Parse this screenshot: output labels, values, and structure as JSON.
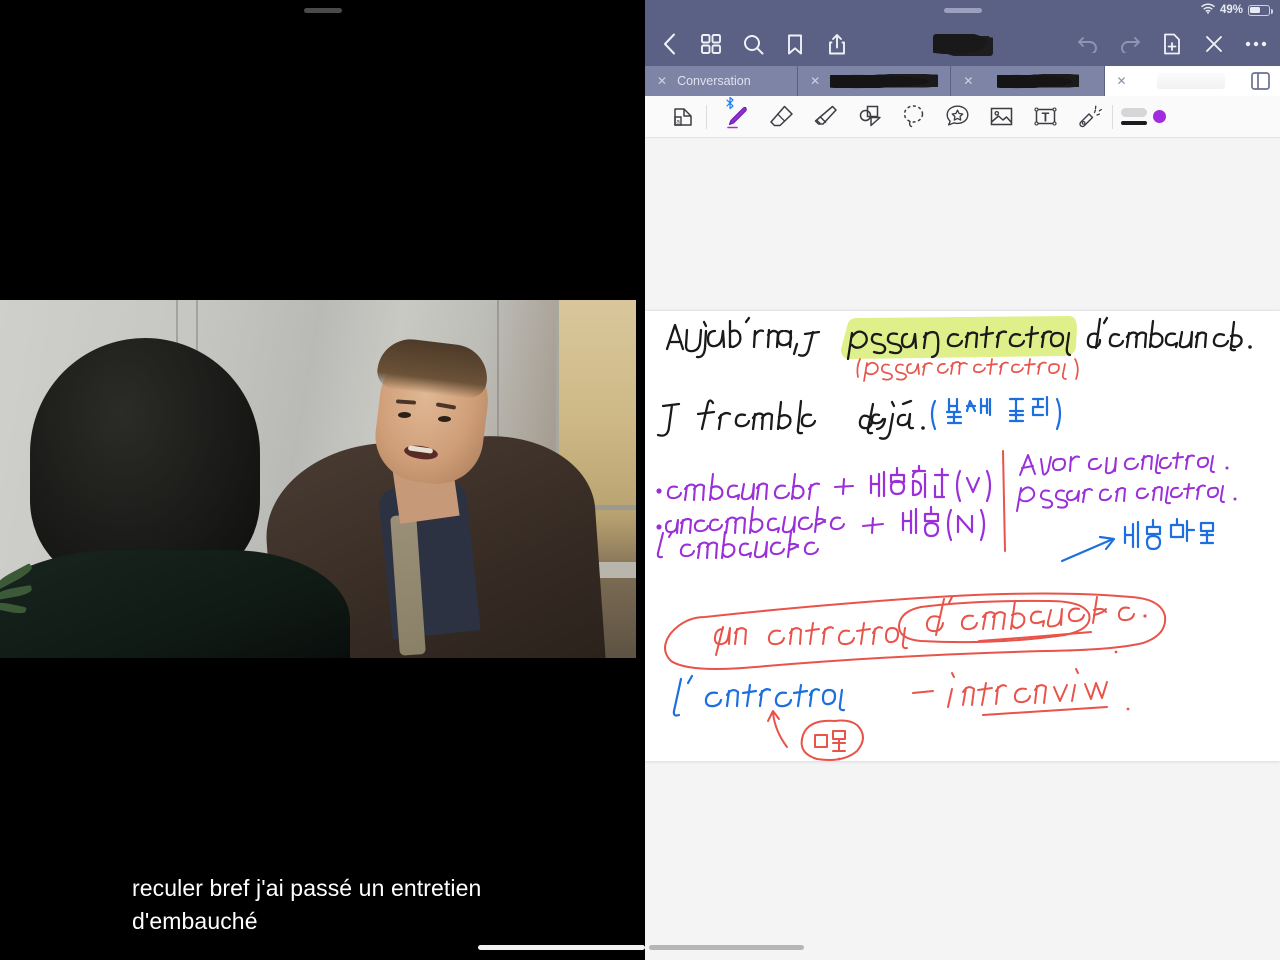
{
  "app": {
    "name": "handwriting-notes-app"
  },
  "video": {
    "subtitle_line1": "reculer bref j'ai passé un entretien",
    "subtitle_line2": "d'embauché",
    "scene_description": "Two men in an office, job interview scene"
  },
  "status_bar": {
    "battery_percent": "49%",
    "wifi_icon": "wifi-icon",
    "battery_icon": "battery-icon",
    "battery_level": 49
  },
  "nav_bar": {
    "back_icon": "back-chevron-icon",
    "grid_icon": "grid-thumbnails-icon",
    "search_icon": "search-icon",
    "bookmark_icon": "bookmark-icon",
    "share_icon": "share-icon",
    "title_redacted": "",
    "undo_icon": "undo-icon",
    "redo_icon": "redo-icon",
    "add_page_icon": "add-page-icon",
    "close_icon": "close-icon",
    "more_icon": "more-ellipsis-icon"
  },
  "tabs": {
    "close_glyph": "✕",
    "items": [
      {
        "label": "Conversation",
        "redacted": false,
        "active": false
      },
      {
        "label": "",
        "redacted": true,
        "active": false
      },
      {
        "label": "",
        "redacted": true,
        "active": false
      },
      {
        "label": "",
        "redacted": true,
        "active": true
      }
    ],
    "split_view_icon": "split-view-icon"
  },
  "toolbar": {
    "tools": [
      {
        "name": "page-flip-tool",
        "selected": false
      },
      {
        "name": "pen-tool",
        "selected": true,
        "bluetooth": true
      },
      {
        "name": "eraser-tool",
        "selected": false
      },
      {
        "name": "highlighter-tool",
        "selected": false
      },
      {
        "name": "shapes-tool",
        "selected": false
      },
      {
        "name": "lasso-select-tool",
        "selected": false
      },
      {
        "name": "sticker-tool",
        "selected": false
      },
      {
        "name": "image-tool",
        "selected": false
      },
      {
        "name": "text-box-tool",
        "selected": false
      },
      {
        "name": "laser-pointer-tool",
        "selected": false
      }
    ],
    "stroke_color": "#a22ae0",
    "bluetooth_glyph": "⌁"
  },
  "note": {
    "colors": {
      "ink_black": "#1a1a1a",
      "ink_purple": "#9b30d9",
      "ink_blue": "#1d6fe0",
      "ink_red": "#e8534a",
      "highlight_yellow": "#dff08a"
    },
    "lines": [
      {
        "id": "l1",
        "text": "Aujourd' hui , je passe un entretien d'embauche.",
        "color": "ink_black",
        "highlight": "passe un entretien"
      },
      {
        "id": "l2",
        "text": "( passer un entretien)",
        "color": "ink_red"
      },
      {
        "id": "l3a",
        "text": "Je tremble",
        "color": "ink_black"
      },
      {
        "id": "l3b",
        "text": "déjà .",
        "color": "ink_black"
      },
      {
        "id": "l3c",
        "text": "( 벌써 덜려)",
        "color": "ink_blue"
      },
      {
        "id": "l4a",
        "text": "• embaucher",
        "color": "ink_purple"
      },
      {
        "id": "l4b",
        "text": "=",
        "color": "ink_purple"
      },
      {
        "id": "l4c",
        "text": "채용하다 (v)",
        "color": "ink_purple"
      },
      {
        "id": "l5a",
        "text": "• une embauche",
        "color": "ink_purple"
      },
      {
        "id": "l5b",
        "text": "l' embauche",
        "color": "ink_purple"
      },
      {
        "id": "l5c",
        "text": "=",
        "color": "ink_purple"
      },
      {
        "id": "l5d",
        "text": "채용 (N)",
        "color": "ink_purple"
      },
      {
        "id": "r1",
        "text": "Avoir un entretien .",
        "color": "ink_purple"
      },
      {
        "id": "r2",
        "text": "passer un entretien.",
        "color": "ink_purple"
      },
      {
        "id": "r3",
        "text": "채용면접",
        "color": "ink_blue"
      },
      {
        "id": "b1",
        "text": "un entretien",
        "color": "ink_red"
      },
      {
        "id": "b2",
        "text": "d'embauche .",
        "color": "ink_red"
      },
      {
        "id": "b3",
        "text": "l' entretien",
        "color": "ink_blue"
      },
      {
        "id": "b4",
        "text": "— interview",
        "color": "ink_red"
      },
      {
        "id": "b5",
        "text": "면접",
        "color": "ink_red"
      }
    ]
  },
  "scrollbar": {
    "name": "horizontal-scrollbar"
  }
}
